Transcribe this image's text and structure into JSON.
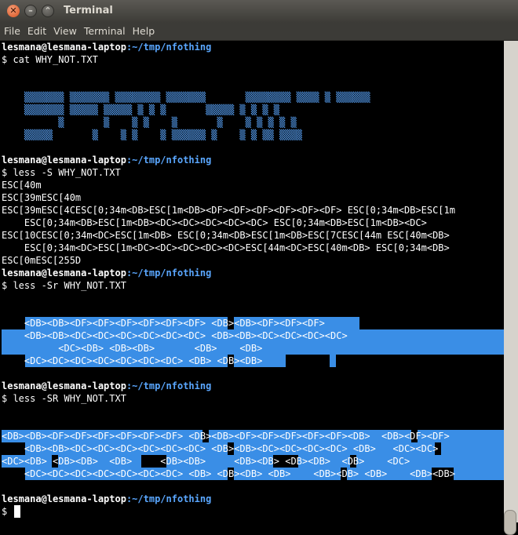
{
  "window": {
    "title": "Terminal",
    "close_glyph": "✕",
    "min_glyph": "–",
    "max_glyph": "⌃"
  },
  "menu": [
    "File",
    "Edit",
    "View",
    "Terminal",
    "Help"
  ],
  "terminal": {
    "prompt_user": "lesmana@lesmana-laptop",
    "prompt_path": ":~/tmp/nfothing",
    "prompt_dollar": "$ ",
    "cmd1": "cat WHY_NOT.TXT",
    "cmd2": "less -S WHY_NOT.TXT",
    "cmd3": "less -Sr WHY_NOT.TXT",
    "cmd4": "less -SR WHY_NOT.TXT",
    "cat_output": [
      "    ▒▒▒▒▒▒▒ ▒▒▒▒▒▒▒ ▒▒▒▒▒▒▒▒ ▒▒▒▒▒▒▒       ▒▒▒▒▒▒▒▒ ▒▒▒▒ ▒ ▒▒▒▒▒▒",
      "    ▒▒▒▒▒▒▒ ▒▒▒▒▒ ▒▒▒▒▒ ▒ ▒ ▒       ▒▒▒▒▒ ▒ ▒ ▒ ▒",
      "          ▒       ▒    ▒ ▒    ▒       ▒    ▒ ▒ ▒ ▒ ▒",
      "    ▒▒▒▒▒       ▒    ▒ ▒    ▒ ▒▒▒▒▒▒ ▒    ▒ ▒ ▒▒ ▒▒▒▒"
    ],
    "less_S_output": [
      "ESC[40m",
      "ESC[39mESC[40m",
      "ESC[39mESC[4CESC[0;34m<DB>ESC[1m<DB><DF><DF><DF><DF><DF><DF> ESC[0;34m<DB>ESC[1m",
      "    ESC[0;34m<DB>ESC[1m<DB><DC><DC><DC><DC><DC> ESC[0;34m<DB>ESC[1m<DB><DC>",
      "ESC[10CESC[0;34m<DC>ESC[1m<DB> ESC[0;34m<DB>ESC[1m<DB>ESC[7CESC[44m ESC[40m<DB>",
      "    ESC[0;34m<DC>ESC[1m<DC><DC><DC><DC><DC>ESC[44m<DC>ESC[40m<DB> ESC[0;34m<DB>",
      "ESC[0mESC[255D"
    ],
    "less_Sr_output": [
      "    <DB><DB><DF><DF><DF><DF><DF><DF> <DB><DB><DF><DF><DF>",
      "    <DB><DB><DC><DC><DC><DC><DC><DC> <DB><DB><DC><DC><DC><DC>",
      "          <DC><DB> <DB><DB>       <DB>    <DB>",
      "    <DC><DC><DC><DC><DC><DC><DC> <DB> <DB><DB>"
    ],
    "less_SR_output": [
      "<DB><DB><DF><DF><DF><DF><DF><DF> <DB><DB><DF><DF><DF><DF><DF><DB>  <DB><DF><DF>",
      "    <DB><DB><DC><DC><DC><DC><DC><DC> <DB><DB><DC><DC><DC><DC> <DB>   <DC><DC>",
      "<DC><DB> <DB><DB>  <DB>     <DB><DB>     <DB><DB> <DB><DB>  <DB>    <DC>",
      "    <DC><DC><DC><DC><DC><DC><DC> <DB> <DB><DB> <DB>    <DB><DB> <DB>    <DB><DB>"
    ]
  }
}
